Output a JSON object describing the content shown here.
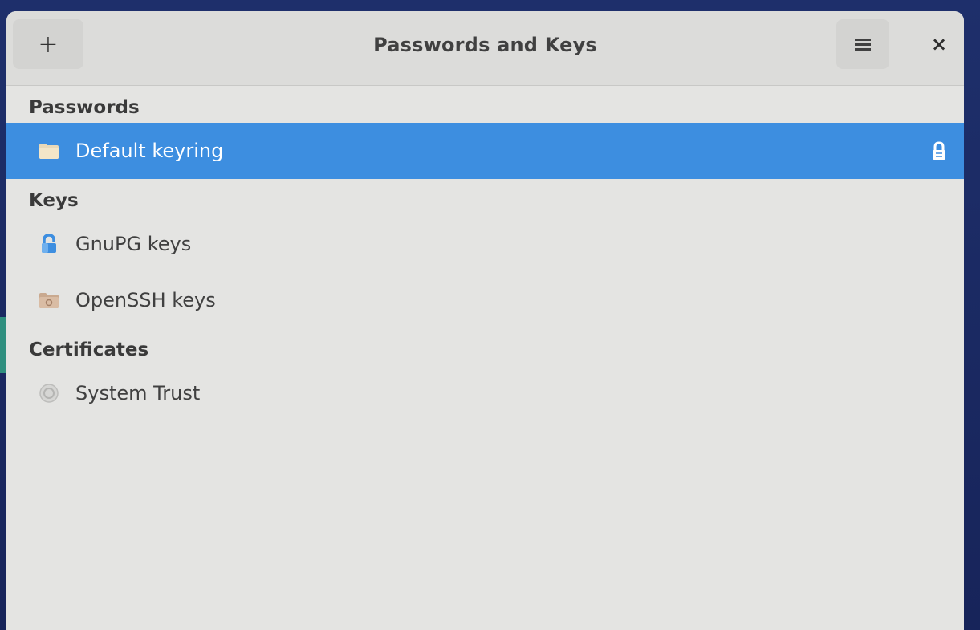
{
  "window": {
    "title": "Passwords and Keys",
    "add_label": "+",
    "close_label": "×"
  },
  "icons": {
    "add": "plus-icon",
    "menu": "hamburger-menu-icon",
    "close": "close-icon",
    "keyring": "folder-keyring-icon",
    "lock": "lock-icon",
    "gnupg": "gnupg-key-icon",
    "openssh": "openssh-folder-icon",
    "trust": "certificate-icon"
  },
  "colors": {
    "selection": "#3d8ee0",
    "background": "#e4e4e2"
  },
  "sections": {
    "passwords": {
      "header": "Passwords",
      "items": [
        {
          "label": "Default keyring",
          "selected": true
        }
      ]
    },
    "keys": {
      "header": "Keys",
      "items": [
        {
          "label": "GnuPG keys"
        },
        {
          "label": "OpenSSH keys"
        }
      ]
    },
    "certificates": {
      "header": "Certificates",
      "items": [
        {
          "label": "System Trust"
        }
      ]
    }
  }
}
